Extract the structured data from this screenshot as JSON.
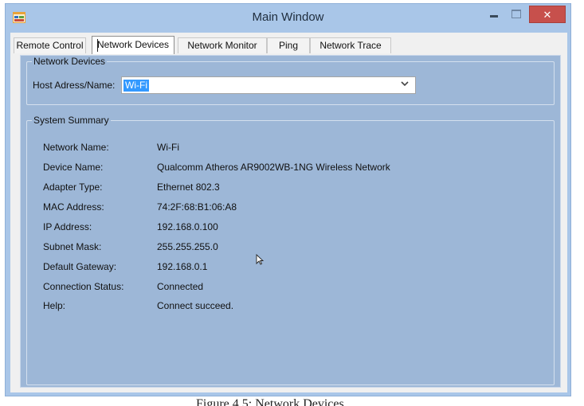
{
  "window": {
    "title": "Main Window",
    "close_glyph": "✕",
    "icons": {
      "app": "app-window-icon",
      "minimize": "minimize-icon",
      "maximize": "maximize-icon",
      "close": "close-icon"
    }
  },
  "tabs": [
    "Remote Control",
    "Network Devices",
    "Network Monitor",
    "Ping",
    "Network Trace"
  ],
  "active_tab": "Network Devices",
  "network_devices_group": {
    "title": "Network Devices",
    "host_label": "Host Adress/Name:",
    "host_value": "Wi-Fi",
    "dropdown_icon": "chevron-down-icon"
  },
  "system_summary": {
    "title": "System Summary",
    "rows": [
      {
        "label": "Network Name:",
        "value": "Wi-Fi"
      },
      {
        "label": "Device Name:",
        "value": "Qualcomm Atheros AR9002WB-1NG Wireless Network"
      },
      {
        "label": "Adapter Type:",
        "value": "Ethernet 802.3"
      },
      {
        "label": "MAC Address:",
        "value": "74:2F:68:B1:06:A8"
      },
      {
        "label": "IP Address:",
        "value": "192.168.0.100"
      },
      {
        "label": "Subnet Mask:",
        "value": "255.255.255.0"
      },
      {
        "label": "Default Gateway:",
        "value": "192.168.0.1"
      },
      {
        "label": "Connection Status:",
        "value": "Connected"
      },
      {
        "label": "Help:",
        "value": "Connect succeed."
      }
    ]
  },
  "colors": {
    "title_bar": "#a9c6e8",
    "tab_page": "#9db7d7",
    "close_button": "#c7504c",
    "selection": "#3399ff"
  },
  "caption": "Figure 4.5: Network Devices"
}
